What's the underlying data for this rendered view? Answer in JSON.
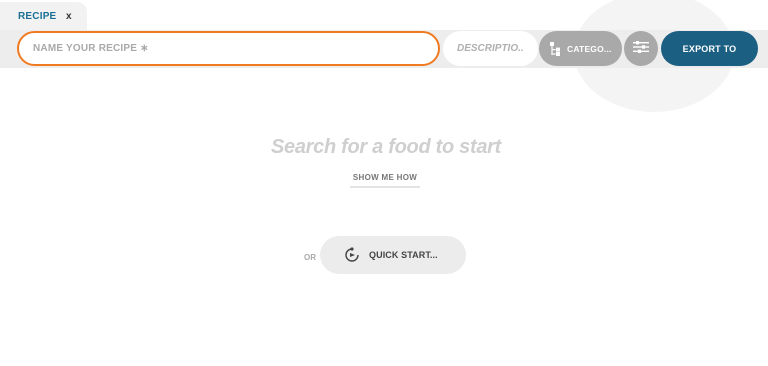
{
  "tab": {
    "label": "RECIPE",
    "close_label": "x"
  },
  "toolbar": {
    "name_placeholder": "NAME YOUR RECIPE ∗",
    "description_placeholder": "DESCRIPTIO...",
    "category_label": "CATEGO...",
    "category_icon": "category-tree-icon",
    "settings_icon": "sliders-icon",
    "export_label": "EXPORT TO"
  },
  "main": {
    "prompt": "Search for a food to start",
    "show_me_how": "SHOW ME HOW",
    "or_label": "OR",
    "quick_start_label": "QUICK START...",
    "quick_start_icon": "quick-start-icon"
  },
  "colors": {
    "accent_orange": "#f07a20",
    "brand_blue": "#1b5f83",
    "tab_blue": "#1b6f95",
    "button_gray": "#a9a9a9"
  }
}
